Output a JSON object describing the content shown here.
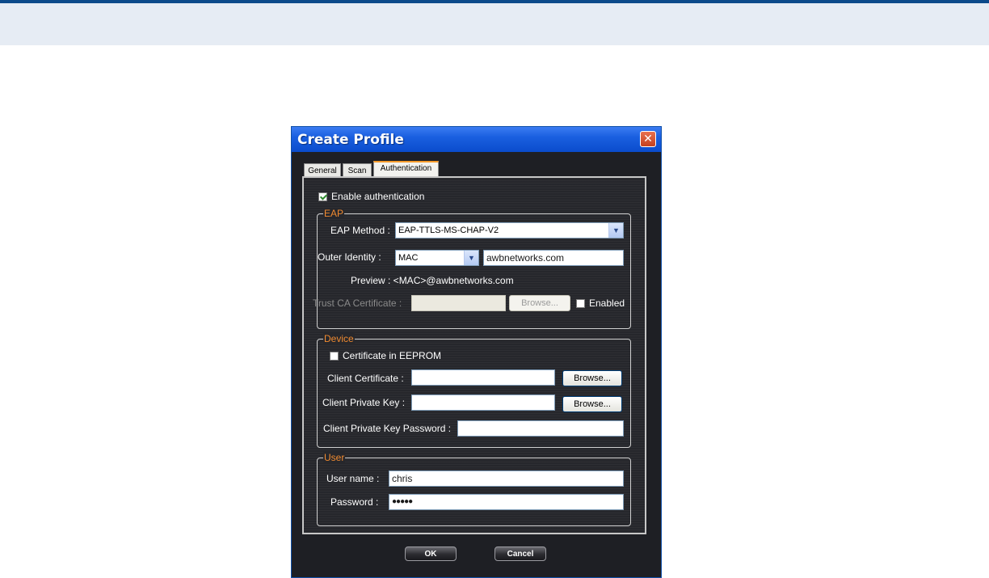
{
  "dialog": {
    "title": "Create Profile",
    "close_glyph": "✕"
  },
  "tabs": [
    {
      "label": "General",
      "active": false
    },
    {
      "label": "Scan",
      "active": false
    },
    {
      "label": "Authentication",
      "active": true
    }
  ],
  "enable_auth": {
    "label": "Enable authentication",
    "checked": true
  },
  "eap": {
    "legend": "EAP",
    "method_label": "EAP Method :",
    "method_value": "EAP-TTLS-MS-CHAP-V2",
    "outer_identity_label": "Outer Identity :",
    "outer_identity_type": "MAC",
    "outer_identity_domain": "awbnetworks.com",
    "preview_text": "Preview : <MAC>@awbnetworks.com",
    "trust_ca_label": "Trust CA Certificate :",
    "trust_ca_value": "",
    "trust_browse_label": "Browse...",
    "enabled_label": "Enabled",
    "enabled_checked": false
  },
  "device": {
    "legend": "Device",
    "cert_eeprom_label": "Certificate in EEPROM",
    "cert_eeprom_checked": false,
    "client_cert_label": "Client Certificate :",
    "client_cert_value": "",
    "client_cert_browse": "Browse...",
    "client_key_label": "Client Private Key :",
    "client_key_value": "",
    "client_key_browse": "Browse...",
    "client_key_pw_label": "Client Private Key Password :",
    "client_key_pw_value": ""
  },
  "user": {
    "legend": "User",
    "username_label": "User name :",
    "username_value": "chris",
    "password_label": "Password :",
    "password_value": "●●●●●"
  },
  "footer": {
    "ok_label": "OK",
    "cancel_label": "Cancel"
  },
  "icons": {
    "checkbox_checked": "check-icon",
    "dropdown_arrow": "chevron-down-icon",
    "close": "close-icon"
  },
  "colors": {
    "title_bar": "#1a5fe0",
    "dialog_bg": "#1e1f24",
    "legend": "#f08a30",
    "active_tab_accent": "#f49a2a"
  }
}
